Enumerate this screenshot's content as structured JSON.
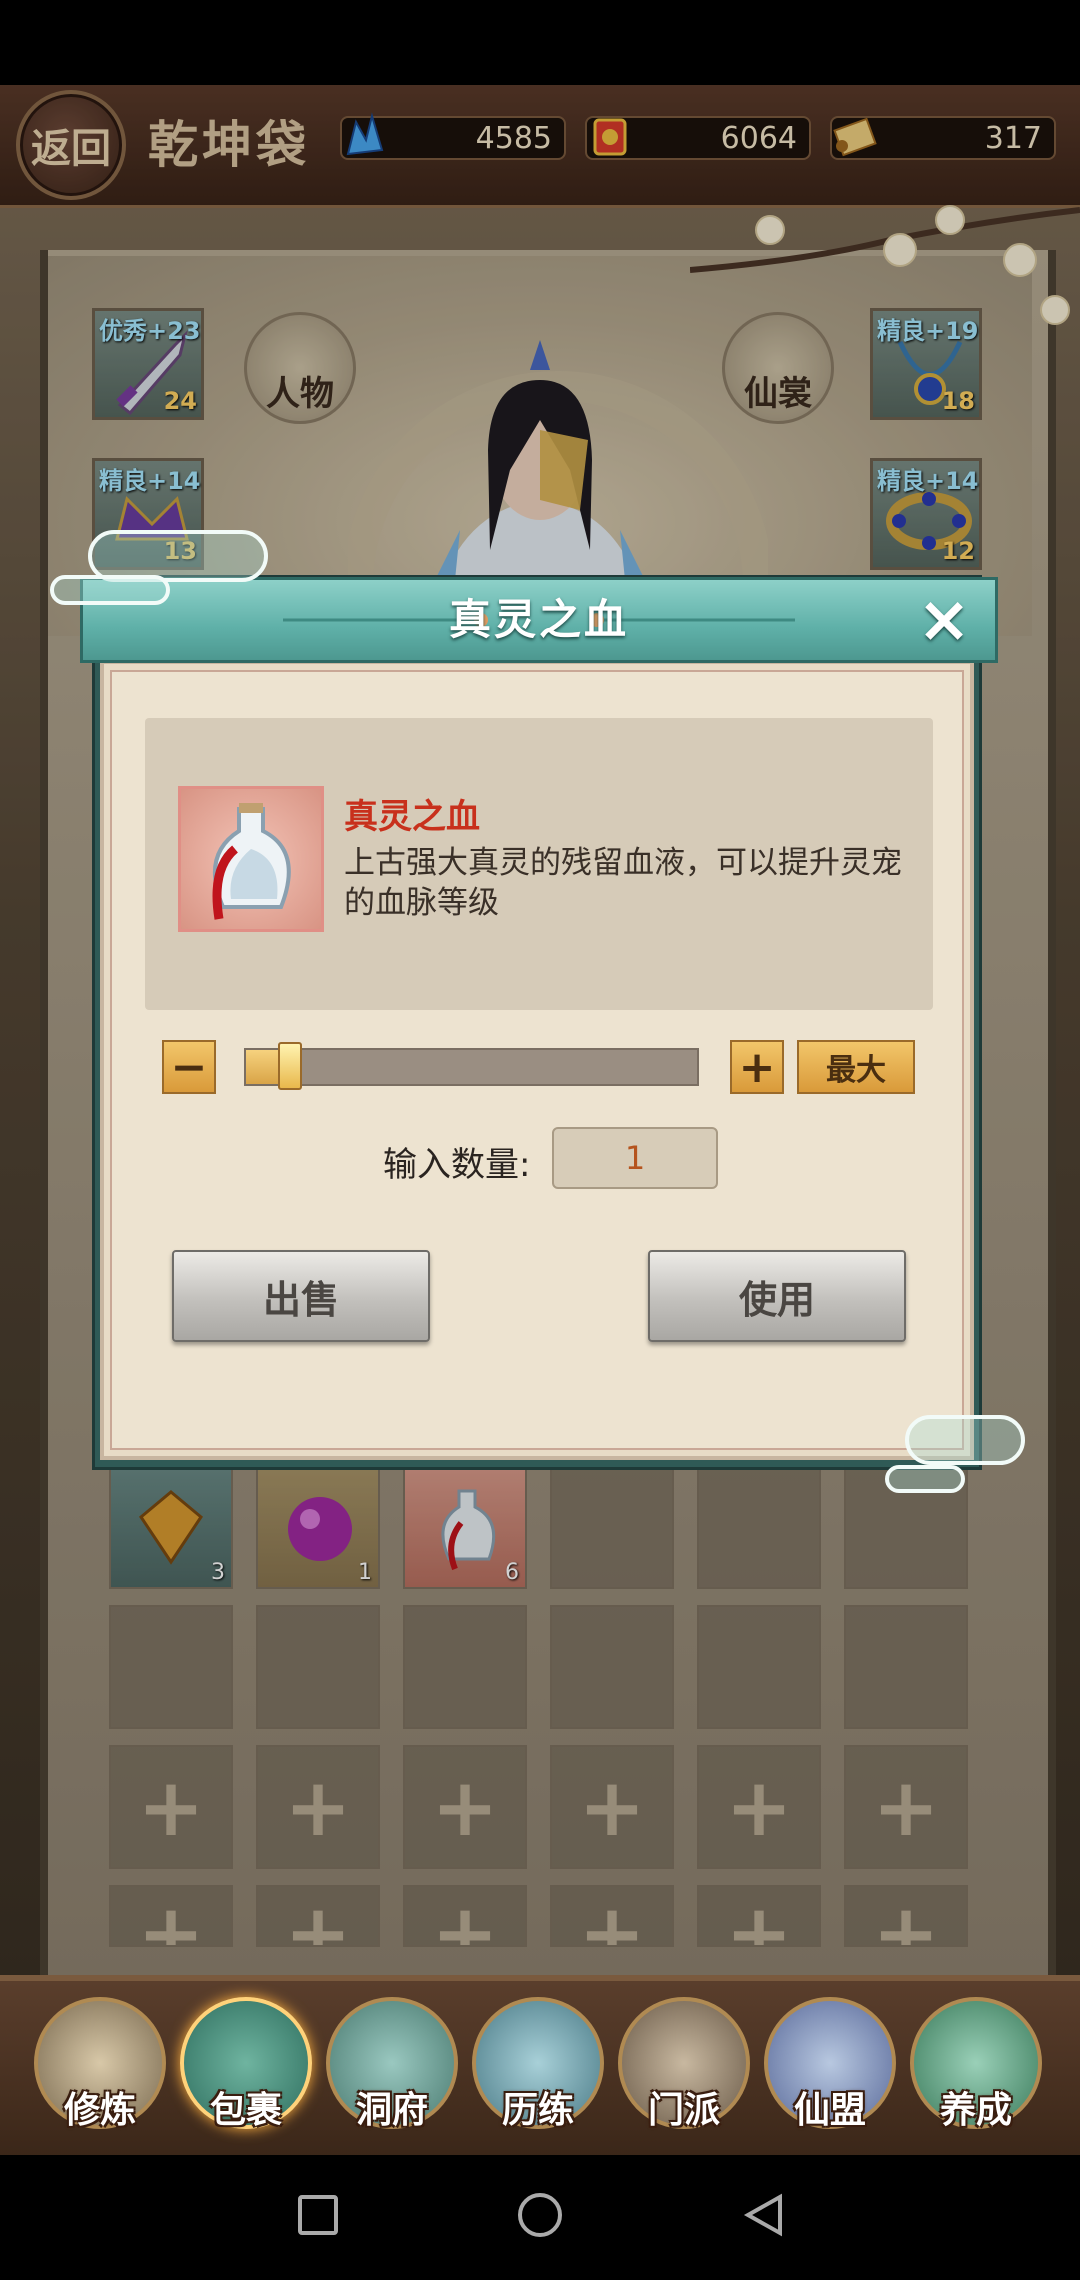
{
  "header": {
    "back_label": "返回",
    "title": "乾坤袋",
    "resources": [
      {
        "name": "spirit-crystal",
        "value": "4585"
      },
      {
        "name": "gold-ingot",
        "value": "6064"
      },
      {
        "name": "scroll",
        "value": "317"
      }
    ]
  },
  "equipment": {
    "left_slots": [
      {
        "label": "优秀+23",
        "count": "24"
      },
      {
        "label": "精良+14",
        "count": "13"
      }
    ],
    "right_slots": [
      {
        "label": "精良+19",
        "count": "18"
      },
      {
        "label": "精良+14",
        "count": "12"
      }
    ],
    "character_button": "人物",
    "costume_button": "仙裳"
  },
  "dialog": {
    "title": "真灵之血",
    "item_name": "真灵之血",
    "item_description": "上古强大真灵的残留血液，可以提升灵宠的血脉等级",
    "slider_fraction": 0.1,
    "max_label": "最大",
    "quantity_label": "输入数量:",
    "quantity_value": "1",
    "sell_label": "出售",
    "use_label": "使用"
  },
  "bag": {
    "items": [
      {
        "name": "token",
        "count": "3"
      },
      {
        "name": "orb",
        "count": "1"
      },
      {
        "name": "vial",
        "count": "6"
      }
    ]
  },
  "bottom_nav": [
    {
      "label": "修炼",
      "icon": "cultivator-icon"
    },
    {
      "label": "包裹",
      "icon": "bag-icon",
      "active": true
    },
    {
      "label": "洞府",
      "icon": "cave-palace-icon"
    },
    {
      "label": "历练",
      "icon": "scroll-map-icon"
    },
    {
      "label": "门派",
      "icon": "sect-gate-icon"
    },
    {
      "label": "仙盟",
      "icon": "alliance-crown-icon"
    },
    {
      "label": "养成",
      "icon": "pentagram-icon"
    }
  ],
  "colors": {
    "dialog_header": "#5fb0a8",
    "item_name_red": "#c8301c",
    "button_gold": "#d99a3a"
  }
}
